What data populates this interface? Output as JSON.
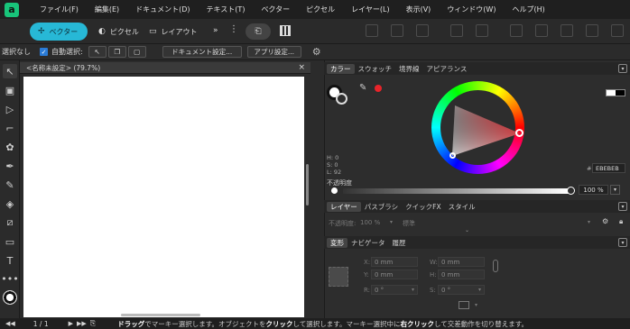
{
  "menu": {
    "items": [
      "ファイル(F)",
      "編集(E)",
      "ドキュメント(D)",
      "テキスト(T)",
      "ベクター",
      "ピクセル",
      "レイヤー(L)",
      "表示(V)",
      "ウィンドウ(W)",
      "ヘルプ(H)"
    ]
  },
  "toolbar": {
    "personas": {
      "vector": "ベクター",
      "pixel": "ピクセル",
      "layout": "レイアウト"
    },
    "more": "»"
  },
  "context": {
    "selection": "選択なし",
    "auto_select": "自動選択:",
    "doc_settings": "ドキュメント設定...",
    "app_settings": "アプリ設定..."
  },
  "document": {
    "tab_title": "<名称未設定> (79.7%)",
    "close": "×"
  },
  "color_panel": {
    "tabs": [
      "カラー",
      "スウォッチ",
      "境界線",
      "アピアランス"
    ],
    "h": "H: 0",
    "s": "S: 0",
    "l": "L: 92",
    "hex": "EBEBEB",
    "opacity_label": "不透明度",
    "opacity_value": "100 %",
    "accent": "#e8242a"
  },
  "layers_panel": {
    "tabs": [
      "レイヤー",
      "パスブラシ",
      "クイックFX",
      "スタイル"
    ],
    "opacity_label": "不透明度:",
    "opacity_value": "100 %",
    "blend": "標準"
  },
  "transform_panel": {
    "tabs": [
      "変形",
      "ナビゲータ",
      "履歴"
    ],
    "x_label": "X:",
    "x_value": "0 mm",
    "y_label": "Y:",
    "y_value": "0 mm",
    "w_label": "W:",
    "w_value": "0 mm",
    "h_label": "H:",
    "h_value": "0 mm",
    "r_label": "R:",
    "r_value": "0 °",
    "s_label": "S:",
    "s_value": "0 °"
  },
  "status": {
    "page": "1 / 1",
    "message_drag": "ドラッグ",
    "message_1": "でマーキー選択します。オブジェクトを",
    "message_click": "クリック",
    "message_2": "して選択します。マーキー選択中に",
    "message_right": "右クリック",
    "message_3": "して交差動作を切り替えます。"
  }
}
